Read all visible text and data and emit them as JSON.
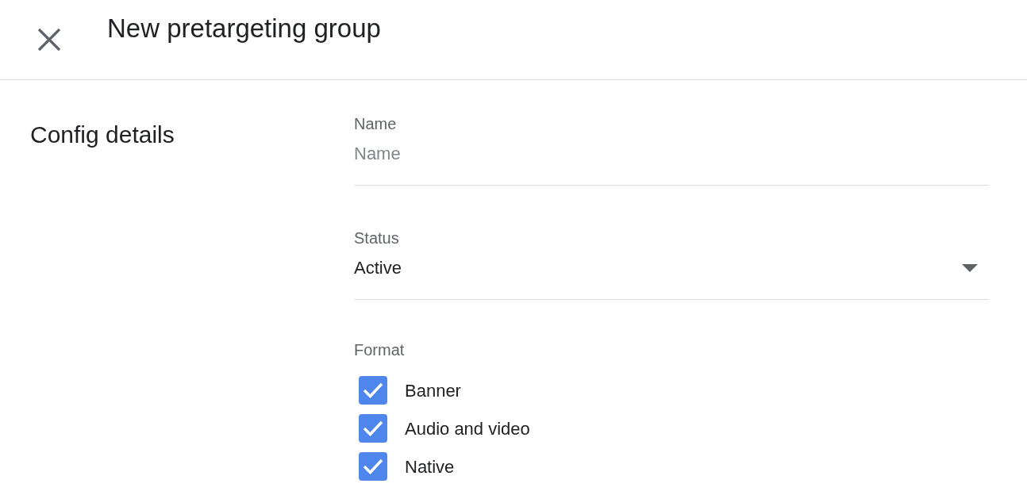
{
  "header": {
    "title": "New pretargeting group"
  },
  "section": {
    "title": "Config details"
  },
  "name_field": {
    "label": "Name",
    "placeholder": "Name"
  },
  "status_field": {
    "label": "Status",
    "value": "Active"
  },
  "format": {
    "label": "Format",
    "options": [
      {
        "label": "Banner",
        "checked": true
      },
      {
        "label": "Audio and video",
        "checked": true
      },
      {
        "label": "Native",
        "checked": true
      }
    ]
  }
}
